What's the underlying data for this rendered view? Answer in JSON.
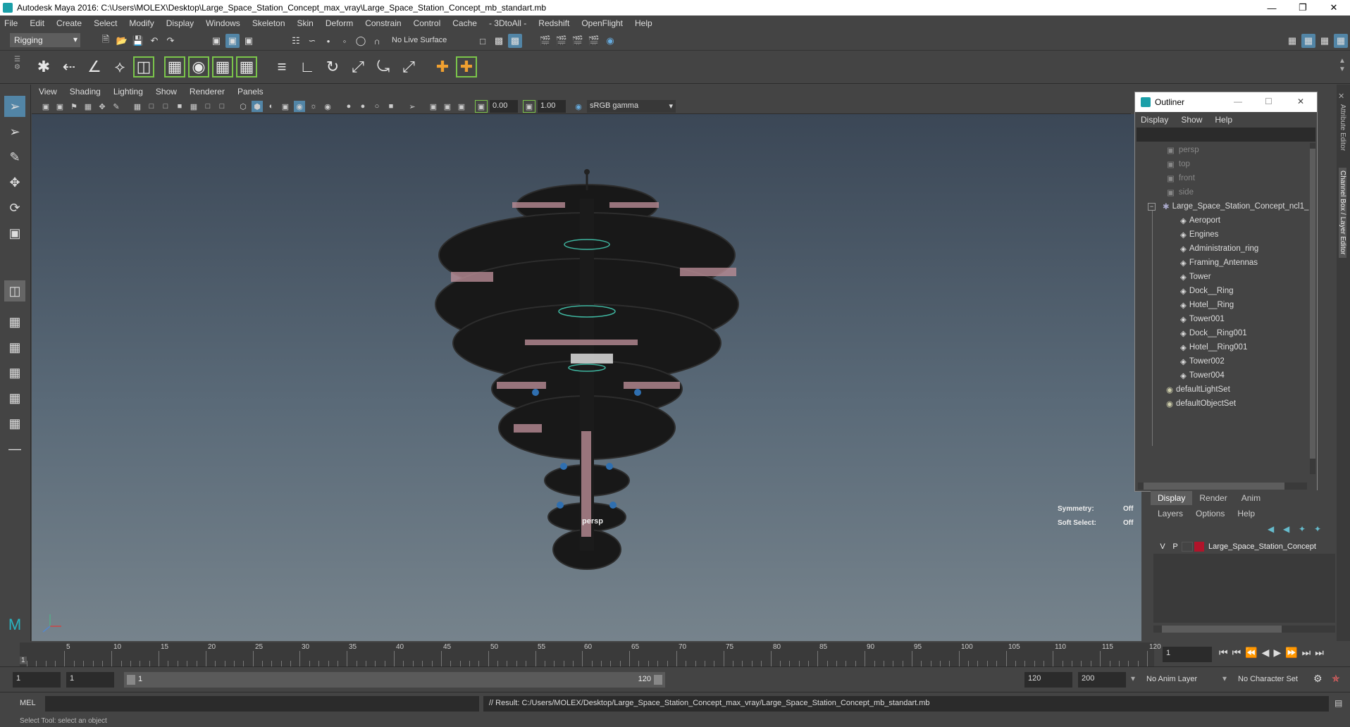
{
  "window": {
    "title": "Autodesk Maya 2016: C:\\Users\\MOLEX\\Desktop\\Large_Space_Station_Concept_max_vray\\Large_Space_Station_Concept_mb_standart.mb"
  },
  "menubar": [
    "File",
    "Edit",
    "Create",
    "Select",
    "Modify",
    "Display",
    "Windows",
    "Skeleton",
    "Skin",
    "Deform",
    "Constrain",
    "Control",
    "Cache",
    "- 3DtoAll -",
    "Redshift",
    "OpenFlight",
    "Help"
  ],
  "statusline": {
    "mode": "Rigging",
    "live_surface": "No Live Surface"
  },
  "panel": {
    "menus": [
      "View",
      "Shading",
      "Lighting",
      "Show",
      "Renderer",
      "Panels"
    ],
    "exposure": "0.00",
    "gamma": "1.00",
    "colorspace": "sRGB gamma",
    "camera_label": "persp",
    "symmetry_label": "Symmetry:",
    "symmetry_value": "Off",
    "soft_select_label": "Soft Select:",
    "soft_select_value": "Off"
  },
  "outliner": {
    "title": "Outliner",
    "menus": [
      "Display",
      "Show",
      "Help"
    ],
    "cameras": [
      "persp",
      "top",
      "front",
      "side"
    ],
    "root": "Large_Space_Station_Concept_ncl1_",
    "children": [
      "Aeroport",
      "Engines",
      "Administration_ring",
      "Framing_Antennas",
      "Tower",
      "Dock__Ring",
      "Hotel__Ring",
      "Tower001",
      "Dock__Ring001",
      "Hotel__Ring001",
      "Tower002",
      "Tower004"
    ],
    "sets": [
      "defaultLightSet",
      "defaultObjectSet"
    ]
  },
  "layer_editor": {
    "tabs": [
      "Display",
      "Render",
      "Anim"
    ],
    "menus": [
      "Layers",
      "Options",
      "Help"
    ],
    "layer": {
      "v": "V",
      "p": "P",
      "name": "Large_Space_Station_Concept",
      "color": "#b0142a"
    }
  },
  "side_tabs": {
    "attribute_editor": "Attribute Editor",
    "channel_box": "Channel Box / Layer Editor"
  },
  "timeline": {
    "ticks": [
      "5",
      "10",
      "15",
      "20",
      "25",
      "30",
      "35",
      "40",
      "45",
      "50",
      "55",
      "60",
      "65",
      "70",
      "75",
      "80",
      "85",
      "90",
      "95",
      "100",
      "105",
      "110",
      "115",
      "120"
    ],
    "start_tick": "1",
    "current_frame": "1"
  },
  "range": {
    "start": "1",
    "playback_start": "1",
    "slider_start": "1",
    "slider_end": "120",
    "playback_end": "120",
    "end": "200",
    "anim_layer": "No Anim Layer",
    "character_set": "No Character Set"
  },
  "command": {
    "lang": "MEL",
    "result": "// Result: C:/Users/MOLEX/Desktop/Large_Space_Station_Concept_max_vray/Large_Space_Station_Concept_mb_standart.mb"
  },
  "help_line": "Select Tool: select an object"
}
